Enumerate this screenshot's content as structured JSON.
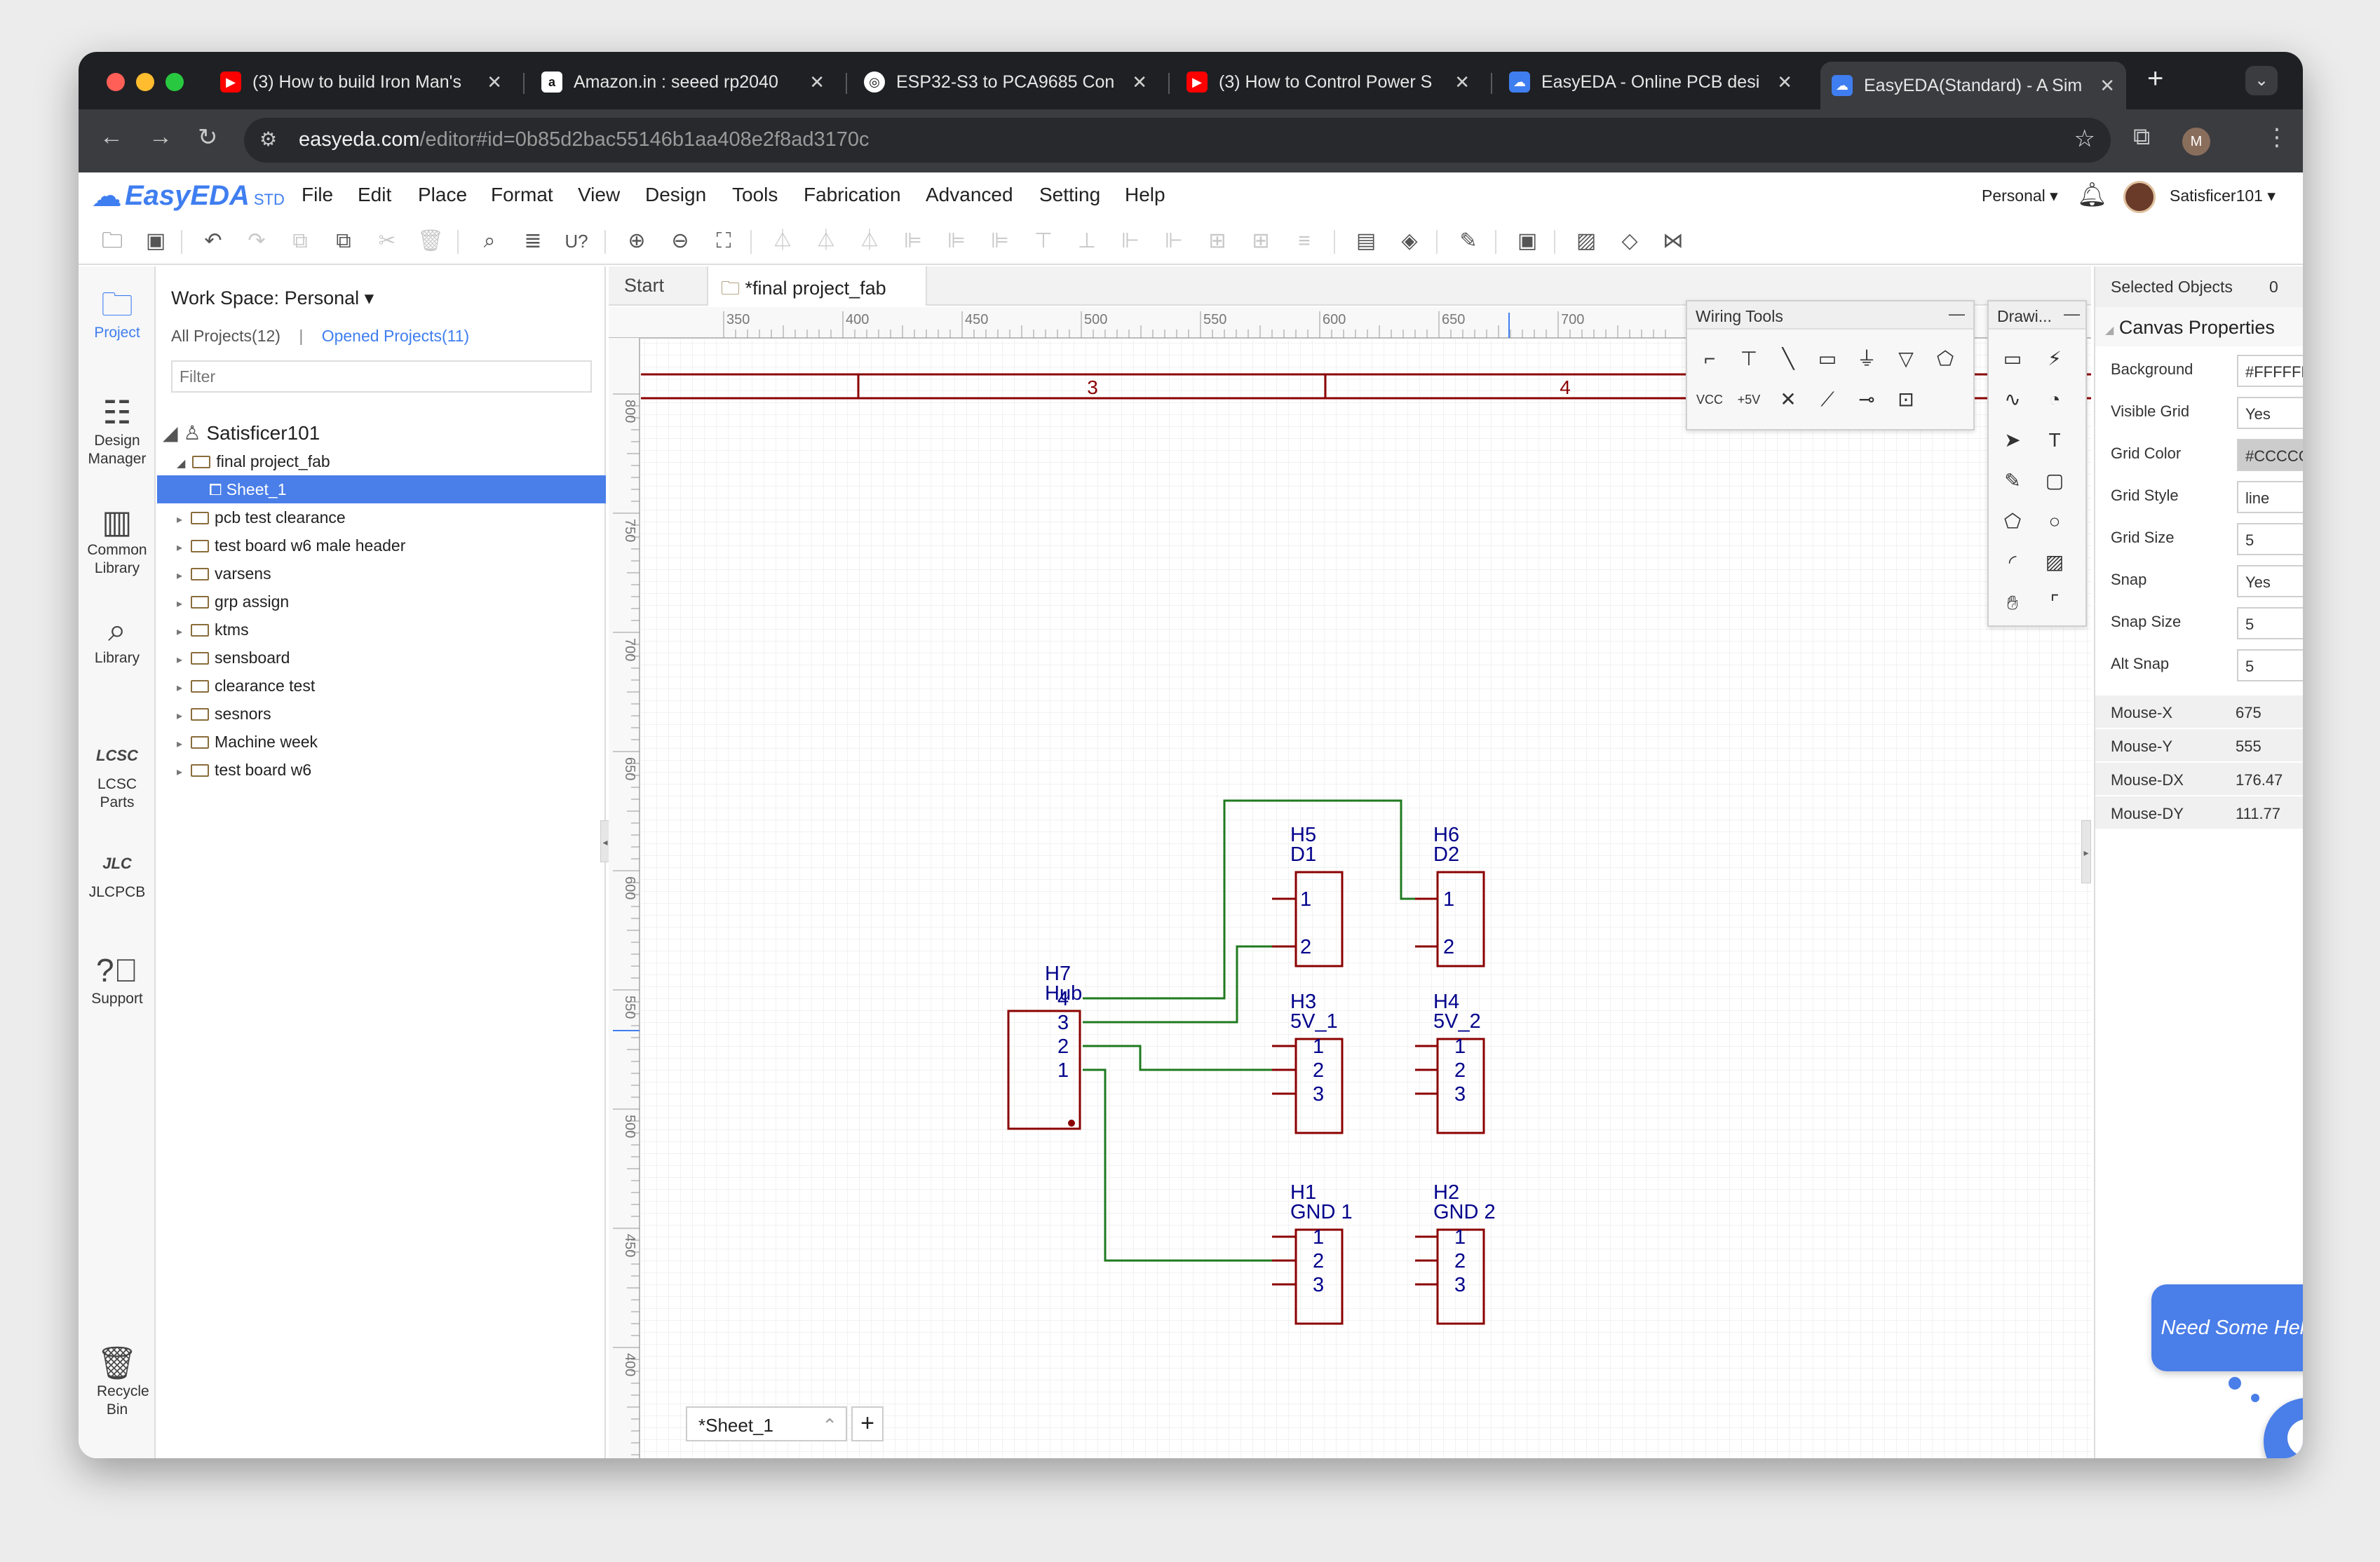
{
  "browser": {
    "tabs": [
      {
        "title": "(3) How to build Iron Man's",
        "icon": "youtube-icon",
        "color": "#ff0000"
      },
      {
        "title": "Amazon.in : seeed rp2040",
        "icon": "amazon-icon",
        "color": "#ffffff"
      },
      {
        "title": "ESP32-S3 to PCA9685 Con",
        "icon": "chatgpt-icon",
        "color": "#ffffff"
      },
      {
        "title": "(3) How to Control Power S",
        "icon": "youtube-icon",
        "color": "#ff0000"
      },
      {
        "title": "EasyEDA - Online PCB desi",
        "icon": "easyeda-icon",
        "color": "#3f7ef0"
      },
      {
        "title": "EasyEDA(Standard) - A Sim",
        "icon": "easyeda-icon",
        "color": "#3f7ef0"
      }
    ],
    "url_host": "easyeda.com",
    "url_path": "/editor#id=0b85d2bac55146b1aa408e2f8ad3170c",
    "profile_initial": "M"
  },
  "app": {
    "logo_text": "EasyEDA",
    "logo_suffix": "STD",
    "menus": [
      "File",
      "Edit",
      "Place",
      "Format",
      "View",
      "Design",
      "Tools",
      "Fabrication",
      "Advanced",
      "Setting",
      "Help"
    ],
    "account_scope": "Personal",
    "username": "Satisficer101"
  },
  "rail": [
    {
      "label": "Project",
      "icon": "folder-icon"
    },
    {
      "label": "Design Manager",
      "icon": "design-manager-icon"
    },
    {
      "label": "Common Library",
      "icon": "chip-icon"
    },
    {
      "label": "Library",
      "icon": "library-search-icon"
    },
    {
      "label": "LCSC Parts",
      "icon": "lcsc-icon"
    },
    {
      "label": "JLCPCB",
      "icon": "jlc-icon"
    },
    {
      "label": "Support",
      "icon": "help-icon"
    },
    {
      "label": "Recycle Bin",
      "icon": "trash-icon"
    }
  ],
  "project_panel": {
    "workspace": "Work Space: Personal",
    "all_projects": "All Projects(12)",
    "opened_projects": "Opened Projects(11)",
    "filter_placeholder": "Filter",
    "root": "Satisficer101",
    "open_project": "final project_fab",
    "selected_sheet": "Sheet_1",
    "projects": [
      "pcb test clearance",
      "test board w6 male header",
      "varsens",
      "grp assign",
      "ktms",
      "sensboard",
      "clearance test",
      "sesnors",
      "Machine week",
      "test board w6"
    ]
  },
  "doc_tabs": {
    "start": "Start",
    "active": "*final project_fab"
  },
  "ruler": {
    "top": [
      "350",
      "400",
      "450",
      "500",
      "550",
      "600",
      "650",
      "700"
    ],
    "left": [
      "800",
      "750",
      "700",
      "650",
      "600",
      "550",
      "500",
      "450",
      "400"
    ]
  },
  "frame_zones": [
    "3",
    "4"
  ],
  "wiring_tools": {
    "title": "Wiring Tools"
  },
  "drawing_tools": {
    "title": "Drawi..."
  },
  "components": [
    {
      "ref": "H5",
      "val": "D1",
      "pins": [
        "1",
        "2"
      ]
    },
    {
      "ref": "H6",
      "val": "D2",
      "pins": [
        "1",
        "2"
      ]
    },
    {
      "ref": "H7",
      "val": "Hub",
      "pins": [
        "4",
        "3",
        "2",
        "1"
      ]
    },
    {
      "ref": "H3",
      "val": "5V_1",
      "pins": [
        "1",
        "2",
        "3"
      ]
    },
    {
      "ref": "H4",
      "val": "5V_2",
      "pins": [
        "1",
        "2",
        "3"
      ]
    },
    {
      "ref": "H1",
      "val": "GND 1",
      "pins": [
        "1",
        "2",
        "3"
      ]
    },
    {
      "ref": "H2",
      "val": "GND 2",
      "pins": [
        "1",
        "2",
        "3"
      ]
    }
  ],
  "sheet_tab": "*Sheet_1",
  "properties": {
    "selected_label": "Selected Objects",
    "selected_count": "0",
    "section": "Canvas Properties",
    "rows": [
      {
        "label": "Background",
        "value": "#FFFFFF",
        "type": "input"
      },
      {
        "label": "Visible Grid",
        "value": "Yes",
        "type": "select"
      },
      {
        "label": "Grid Color",
        "value": "#CCCCCC",
        "type": "input"
      },
      {
        "label": "Grid Style",
        "value": "line",
        "type": "select"
      },
      {
        "label": "Grid Size",
        "value": "5",
        "type": "input"
      },
      {
        "label": "Snap",
        "value": "Yes",
        "type": "select"
      },
      {
        "label": "Snap Size",
        "value": "5",
        "type": "input"
      },
      {
        "label": "Alt Snap",
        "value": "5",
        "type": "input"
      }
    ],
    "mouse": [
      {
        "label": "Mouse-X",
        "value": "675"
      },
      {
        "label": "Mouse-Y",
        "value": "555"
      },
      {
        "label": "Mouse-DX",
        "value": "176.47"
      },
      {
        "label": "Mouse-DY",
        "value": "111.77"
      }
    ]
  },
  "help_bubble": "Need Some Help?",
  "colors": {
    "accent": "#3f7ef0",
    "schematic_red": "#8b0000",
    "wire_green": "#1f7a1f",
    "pin_blue": "#00008b",
    "selection": "#4a7ee8"
  }
}
